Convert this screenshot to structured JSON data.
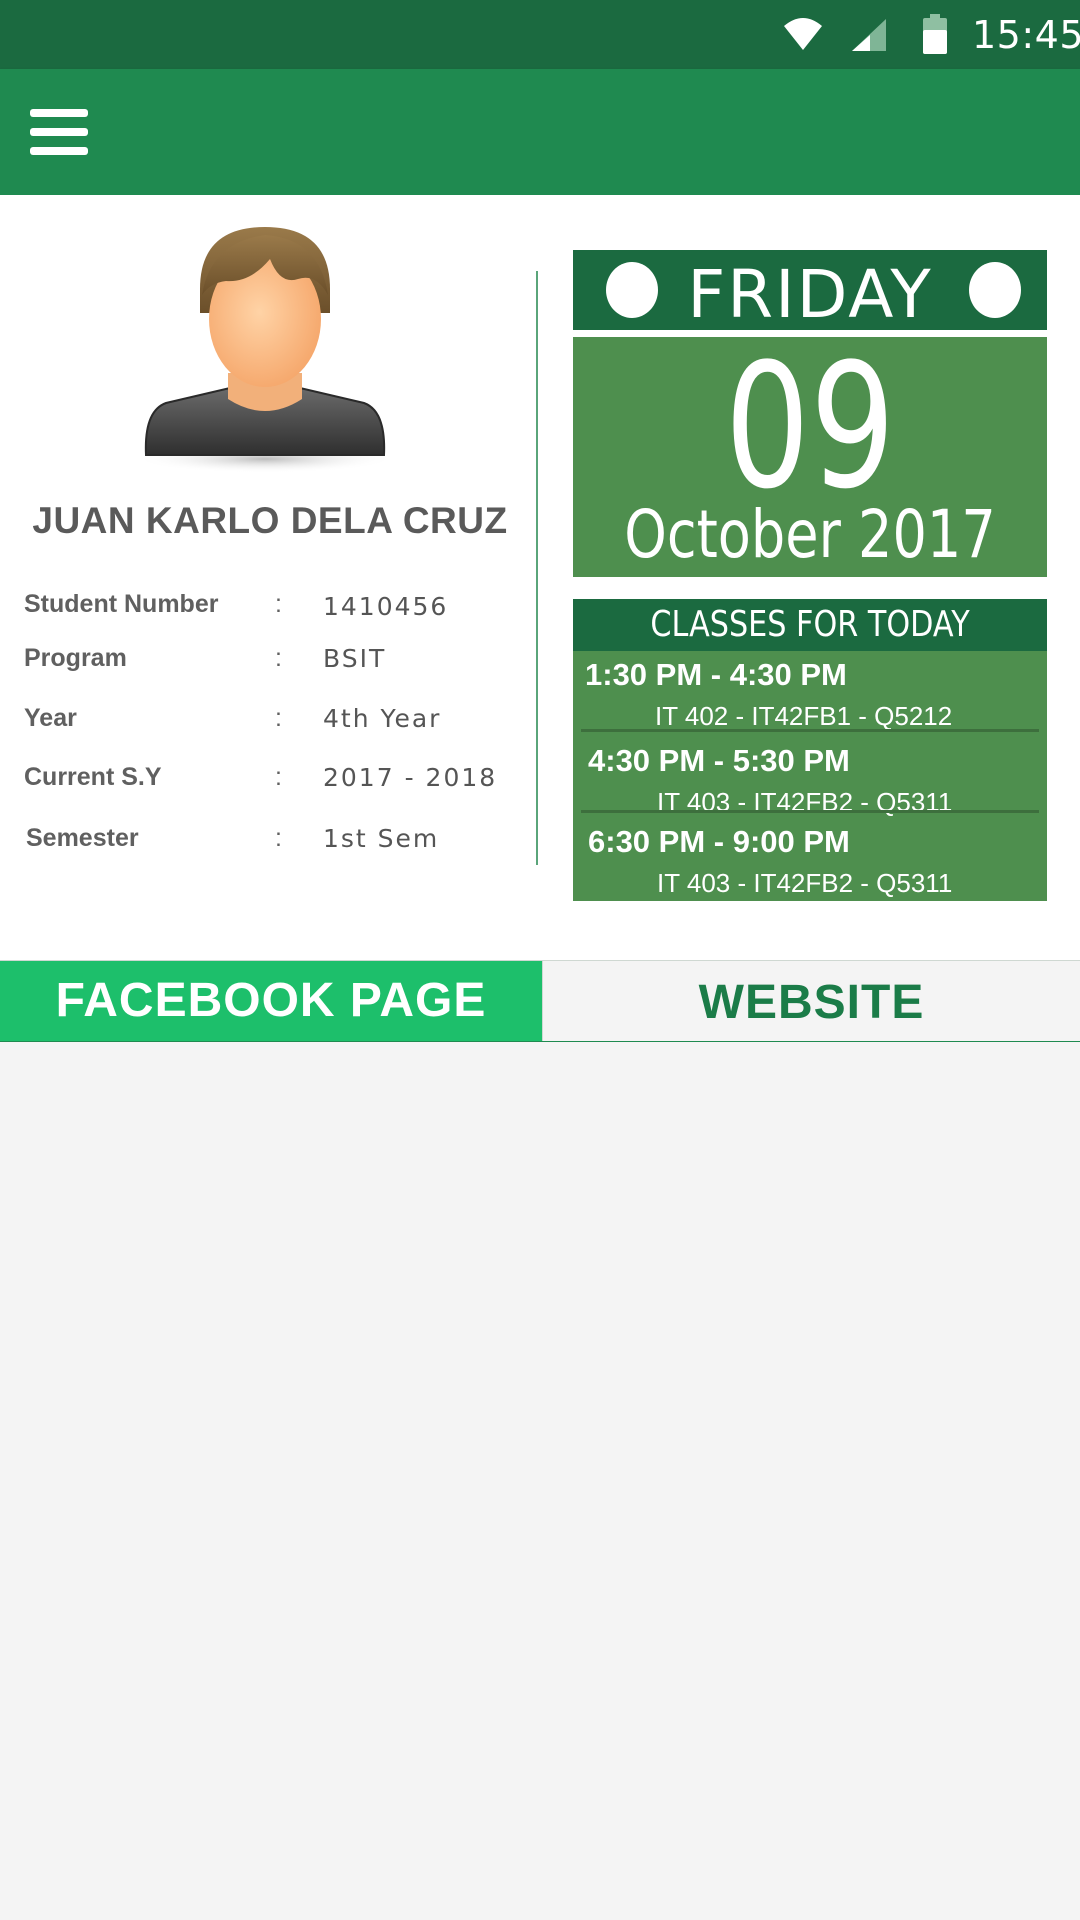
{
  "status_bar": {
    "time": "15:45",
    "icons": [
      "wifi-icon",
      "cell-signal-icon",
      "battery-icon"
    ]
  },
  "app_bar": {
    "menu_icon": "hamburger-menu-icon"
  },
  "profile": {
    "avatar_icon": "user-avatar-icon",
    "name": "JUAN KARLO DELA CRUZ",
    "fields": [
      {
        "label": "Student Number",
        "sep": ":",
        "value": "1410456"
      },
      {
        "label": "Program",
        "sep": ":",
        "value": "BSIT"
      },
      {
        "label": "Year",
        "sep": ":",
        "value": "4th Year"
      },
      {
        "label": "Current S.Y",
        "sep": ":",
        "value": "2017 - 2018"
      },
      {
        "label": "Semester",
        "sep": ":",
        "value": "1st Sem"
      }
    ]
  },
  "calendar": {
    "day_name": "FRIDAY",
    "day": "09",
    "month_year": "October 2017"
  },
  "classes": {
    "header": "CLASSES FOR TODAY",
    "items": [
      {
        "time": "1:30 PM - 4:30 PM",
        "detail": "IT 402 - IT42FB1 - Q5212"
      },
      {
        "time": "4:30 PM - 5:30 PM",
        "detail": "IT 403 - IT42FB2 - Q5311"
      },
      {
        "time": "6:30 PM - 9:00 PM",
        "detail": "IT 403 - IT42FB2 - Q5311"
      }
    ]
  },
  "links": {
    "facebook_label": "FACEBOOK PAGE",
    "website_label": "WEBSITE"
  },
  "colors": {
    "status_bar": "#1b6a40",
    "app_bar": "#1f8a50",
    "calendar_dark": "#1b6a40",
    "calendar_light": "#4e8f4e",
    "facebook_button": "#1dbf6b",
    "website_text": "#1b7c48"
  }
}
